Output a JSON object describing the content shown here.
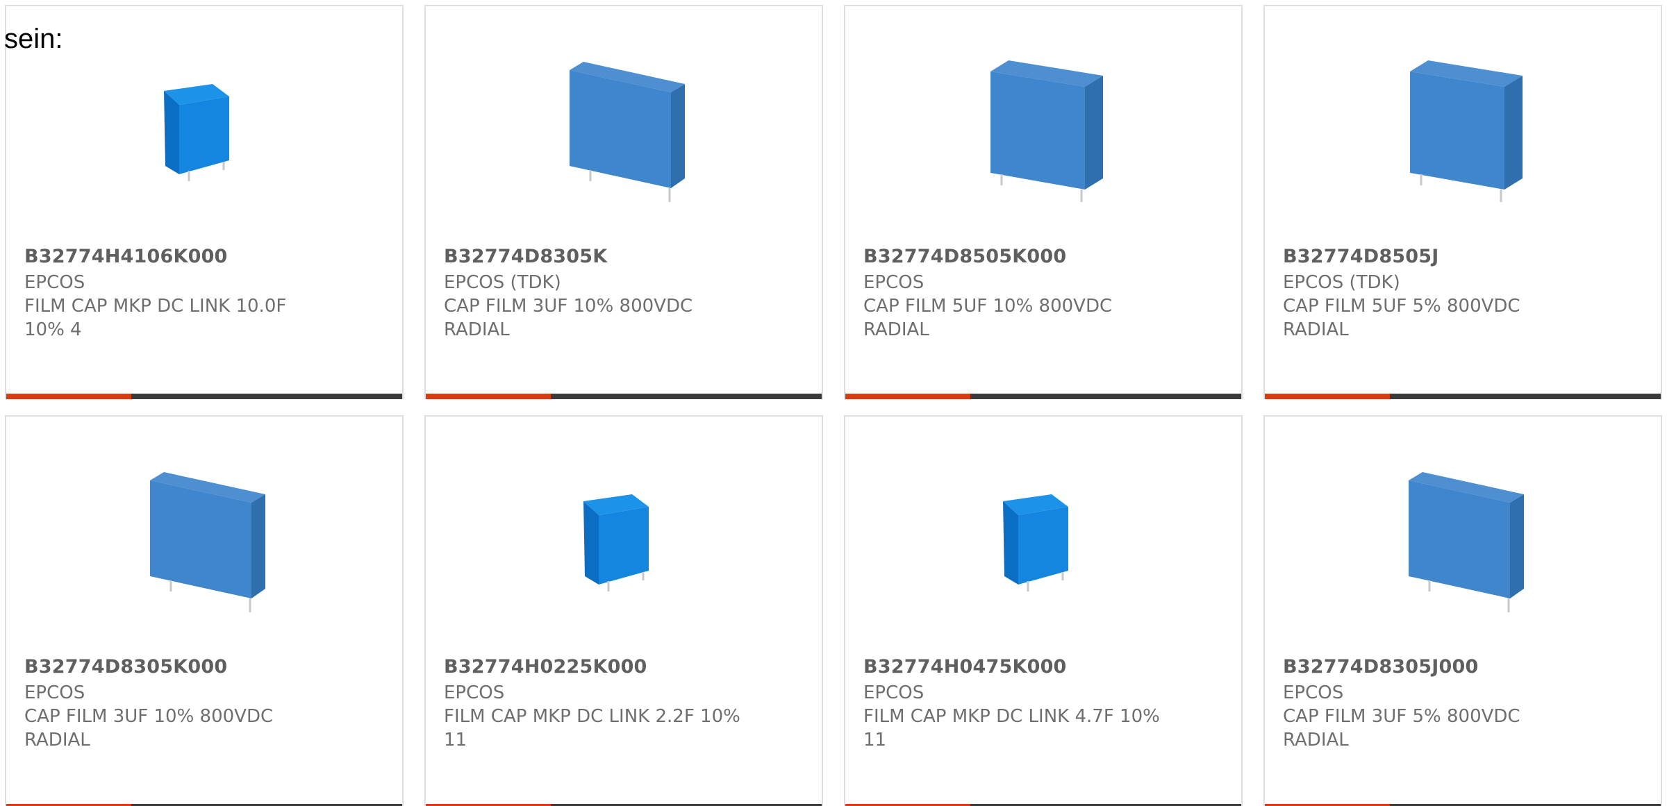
{
  "intro_text": "sein:",
  "colors": {
    "accent": "#dc3a12",
    "bar_track": "#3b3b3b",
    "border": "#dedede",
    "title_text": "#5f5f5f",
    "body_text": "#6e6e6e",
    "capacitor_blue": "#2f7fc8",
    "capacitor_bright_blue": "#1a86e0"
  },
  "products": [
    {
      "part_number": "B32774H4106K000",
      "manufacturer": "EPCOS",
      "description": "FILM CAP MKP DC LINK 10.0F 10% 4",
      "image": "capacitor-small-cube-icon",
      "bar_fraction": 0.315
    },
    {
      "part_number": "B32774D8305K",
      "manufacturer": "EPCOS (TDK)",
      "description": "CAP FILM 3UF 10% 800VDC RADIAL",
      "image": "capacitor-wide-box-icon",
      "bar_fraction": 0.315
    },
    {
      "part_number": "B32774D8505K000",
      "manufacturer": "EPCOS",
      "description": "CAP FILM 5UF 10% 800VDC RADIAL",
      "image": "capacitor-large-box-icon",
      "bar_fraction": 0.315
    },
    {
      "part_number": "B32774D8505J",
      "manufacturer": "EPCOS (TDK)",
      "description": "CAP FILM 5UF 5% 800VDC RADIAL",
      "image": "capacitor-large-box-icon",
      "bar_fraction": 0.315
    },
    {
      "part_number": "B32774D8305K000",
      "manufacturer": "EPCOS",
      "description": "CAP FILM 3UF 10% 800VDC RADIAL",
      "image": "capacitor-wide-box-icon",
      "bar_fraction": 0.315
    },
    {
      "part_number": "B32774H0225K000",
      "manufacturer": "EPCOS",
      "description": "FILM CAP MKP DC LINK 2.2F 10% 11",
      "image": "capacitor-small-cube-icon",
      "bar_fraction": 0.315
    },
    {
      "part_number": "B32774H0475K000",
      "manufacturer": "EPCOS",
      "description": "FILM CAP MKP DC LINK 4.7F 10% 11",
      "image": "capacitor-small-cube-icon",
      "bar_fraction": 0.315
    },
    {
      "part_number": "B32774D8305J000",
      "manufacturer": "EPCOS",
      "description": "CAP FILM 3UF 5% 800VDC RADIAL",
      "image": "capacitor-wide-box-icon",
      "bar_fraction": 0.315
    }
  ]
}
